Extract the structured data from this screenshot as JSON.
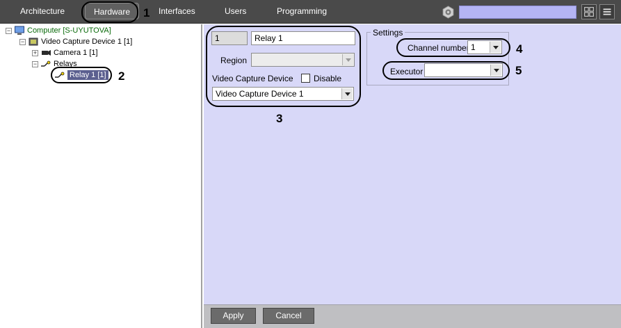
{
  "tabs": [
    {
      "label": "Architecture",
      "active": false
    },
    {
      "label": "Hardware",
      "active": true
    },
    {
      "label": "Interfaces",
      "active": false
    },
    {
      "label": "Users",
      "active": false
    },
    {
      "label": "Programming",
      "active": false
    }
  ],
  "search": {
    "value": ""
  },
  "tree": {
    "computer": "Computer [S-UYUTOVA]",
    "video_capture_device": "Video Capture Device 1 [1]",
    "camera": "Camera 1 [1]",
    "relays": "Relays",
    "relay": "Relay 1 [1]"
  },
  "object_panel": {
    "id_value": "1",
    "name_value": "Relay 1",
    "region_label": "Region",
    "region_value": "",
    "device_label": "Video Capture Device",
    "disable_label": "Disable",
    "disable_checked": false,
    "device_value": "Video Capture Device 1"
  },
  "settings": {
    "group_title": "Settings",
    "channel_label": "Channel number",
    "channel_value": "1",
    "executor_label": "Executor",
    "executor_value": ""
  },
  "buttons": {
    "apply": "Apply",
    "cancel": "Cancel"
  },
  "callouts": [
    "1",
    "2",
    "3",
    "4",
    "5"
  ],
  "colors": {
    "topbar": "#4a4a4a",
    "panel": "#d8d8f8",
    "search": "#b4b4f4",
    "tree_selected": "#5b5f8f",
    "computer_text": "#0a6a0a"
  }
}
